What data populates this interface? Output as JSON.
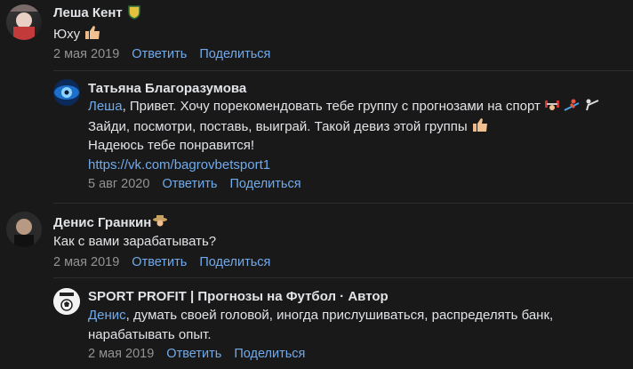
{
  "comments": [
    {
      "author": "Леша Кент",
      "text": "Юху",
      "date": "2 мая 2019",
      "reply": "Ответить",
      "share": "Поделиться"
    },
    {
      "author": "Татьяна Благоразумова",
      "mention": "Леша",
      "line1": ", Привет. Хочу порекомендовать тебе группу с прогнозами на спорт",
      "line2": "Зайди, посмотри, поставь, выиграй. Такой девиз этой группы",
      "line3": "Надеюсь тебе понравится!",
      "link": "https://vk.com/bagrovbetsport1",
      "date": "5 авг 2020",
      "reply": "Ответить",
      "share": "Поделиться"
    },
    {
      "author": "Денис Гранкин",
      "text": "Как с вами зарабатывать?",
      "date": "2 мая 2019",
      "reply": "Ответить",
      "share": "Поделиться"
    },
    {
      "author": "SPORT PROFIT | Прогнозы на Футбол · Автор",
      "mention": "Денис",
      "line1": ", думать своей головой, иногда прислушиваться, распределять банк,",
      "line2": "нарабатывать опыт.",
      "date": "2 мая 2019",
      "reply": "Ответить",
      "share": "Поделиться"
    }
  ],
  "colors": {
    "background": "#19191a",
    "link": "#71aaeb",
    "meta": "#939393"
  },
  "icons": [
    "thumbs-up-icon",
    "team-badge-icon",
    "weightlifter-icon",
    "skier-icon",
    "fencer-icon",
    "hat-icon"
  ]
}
